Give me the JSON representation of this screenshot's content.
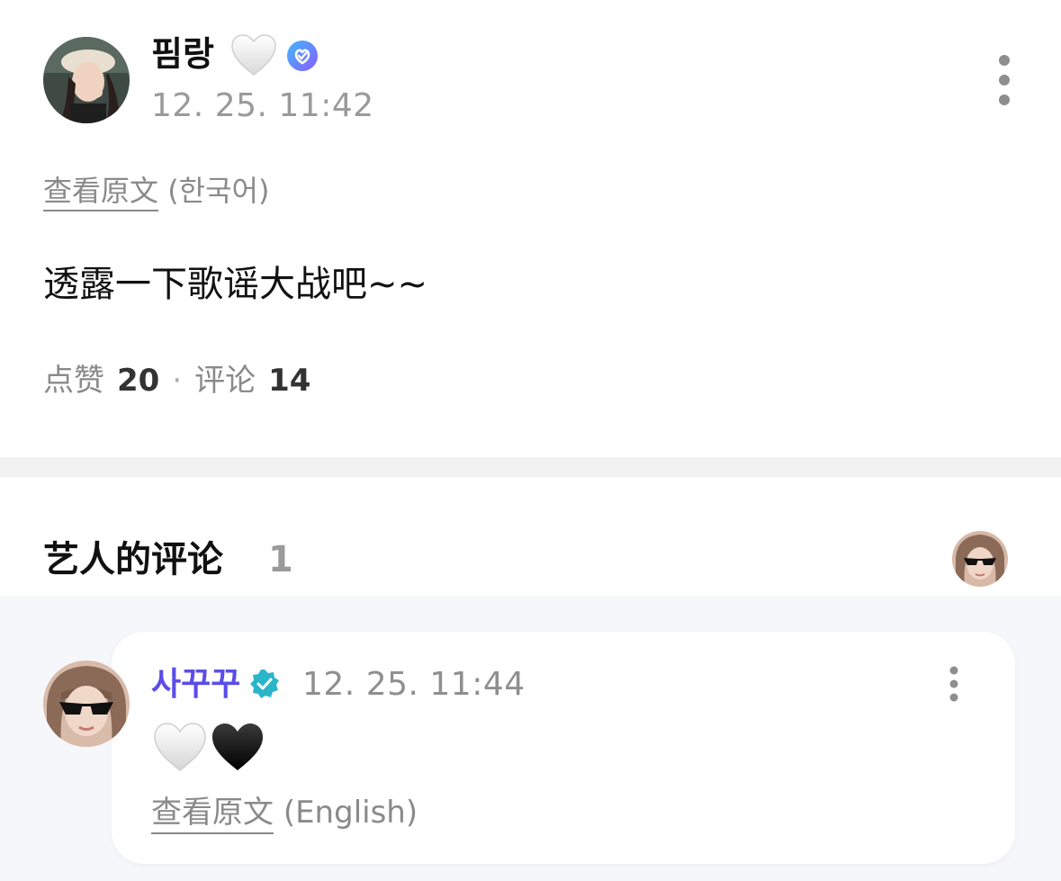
{
  "post": {
    "author": "핌랑",
    "author_heart_icon": "white-heart-icon",
    "verified_icon": "verified-badge-icon",
    "timestamp": "12. 25. 11:42",
    "more_icon": "more-vertical-icon",
    "translate_link": "查看原文",
    "translate_lang": "(한국어)",
    "body": "透露一下歌谣大战吧~~",
    "stats": {
      "likes_label": "点赞",
      "likes_count": "20",
      "separator": "·",
      "comments_label": "评论",
      "comments_count": "14"
    }
  },
  "artist_comments": {
    "title": "艺人的评论",
    "count": "1",
    "comment": {
      "author": "사꾸꾸",
      "author_color": "#5b4de8",
      "verified_icon": "verified-badge-icon",
      "timestamp": "12. 25. 11:44",
      "more_icon": "more-vertical-icon",
      "content_icons": [
        "white-heart-icon",
        "black-heart-icon"
      ],
      "translate_link": "查看原文",
      "translate_lang": "(English)"
    }
  },
  "colors": {
    "accent_purple": "#5b4de8",
    "muted_text": "#8a8a8a",
    "divider": "#f2f2f2",
    "comment_bg": "#f6f7fb"
  }
}
